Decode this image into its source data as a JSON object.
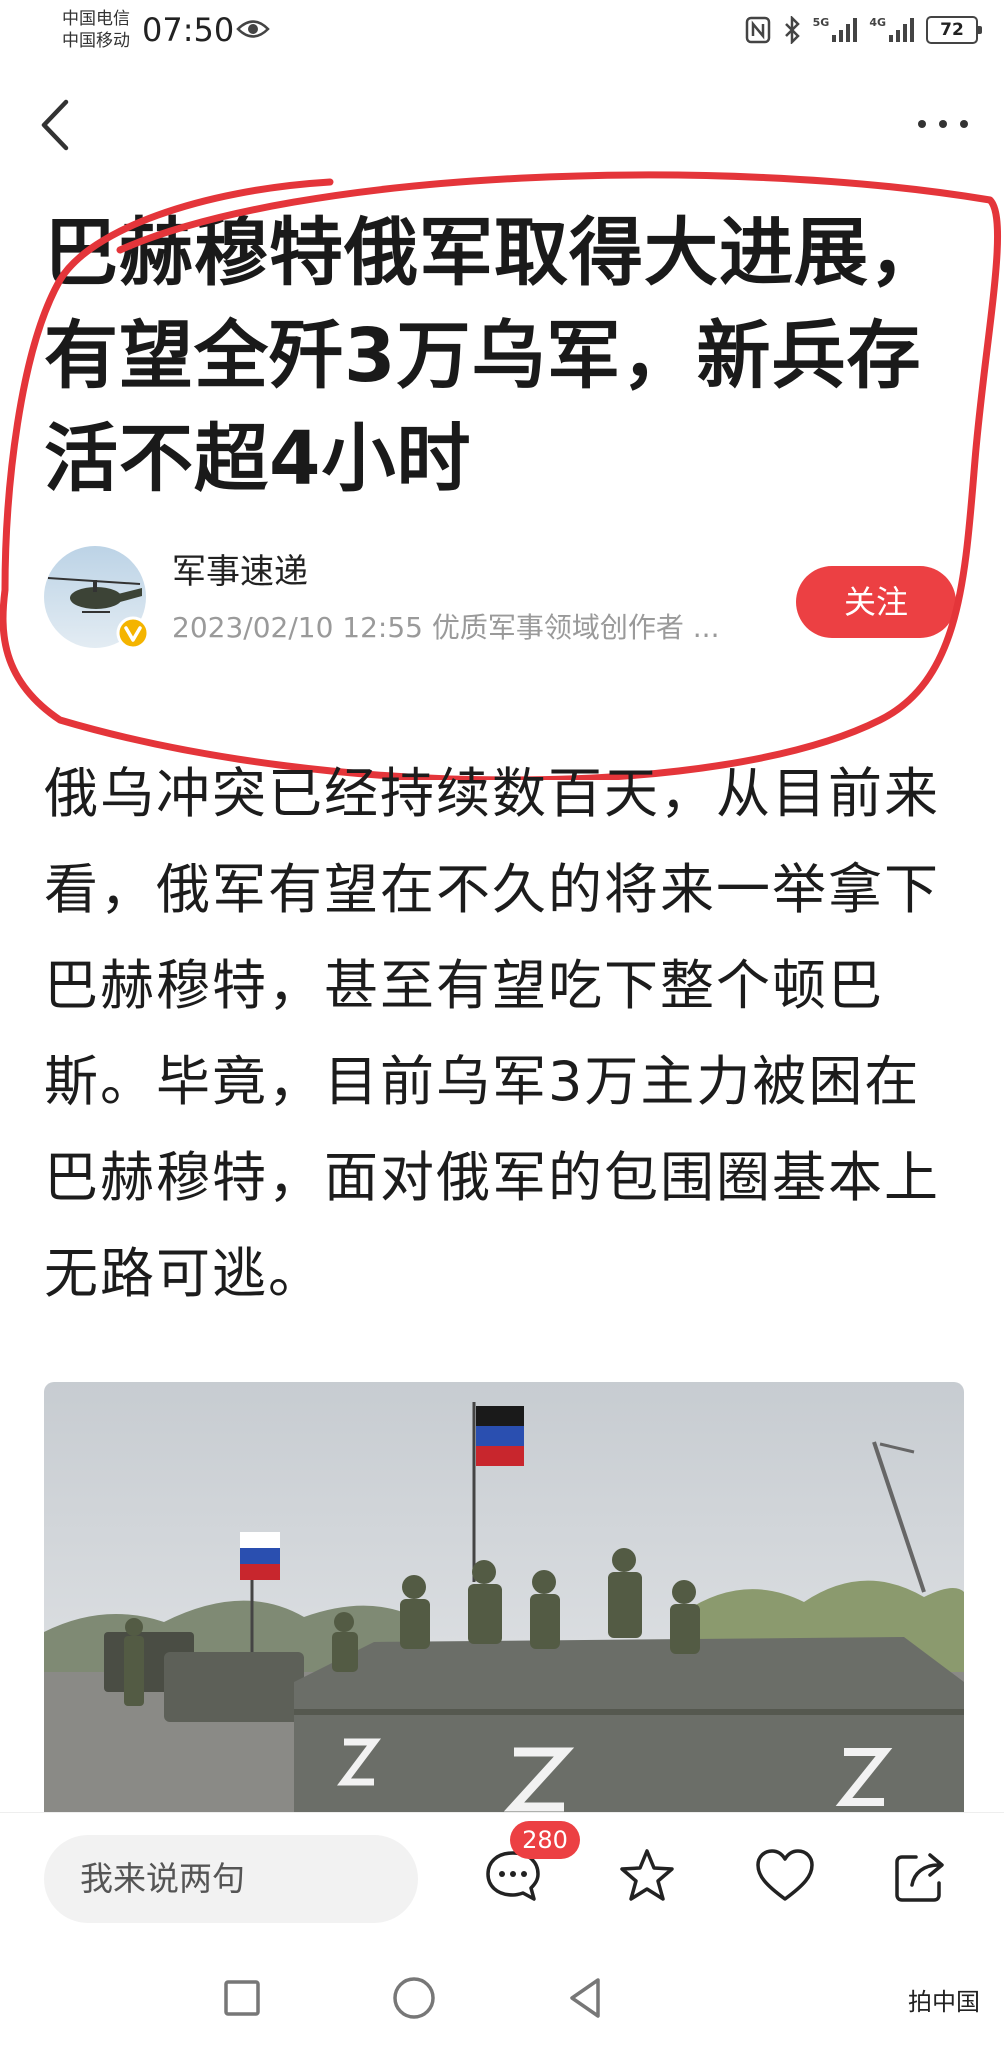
{
  "status_bar": {
    "carrier_1": "中国电信",
    "carrier_2": "中国移动",
    "time": "07:50",
    "signal_label_1": "5G",
    "signal_label_2": "4G",
    "battery": "72"
  },
  "article": {
    "headline": "巴赫穆特俄军取得大进展，有望全歼3万乌军，新兵存活不超4小时",
    "author": {
      "name": "军事速递",
      "meta": "2023/02/10 12:55  优质军事领域创作者 ..."
    },
    "follow_label": "关注",
    "body": "俄乌冲突已经持续数百天，从目前来看，俄军有望在不久的将来一举拿下巴赫穆特，甚至有望吃下整个顿巴斯。毕竟，目前乌军3万主力被困在巴赫穆特，面对俄军的包围圈基本上无路可逃。"
  },
  "action_bar": {
    "comment_placeholder": "我来说两句",
    "comment_count": "280"
  },
  "watermark": "拍中国",
  "colors": {
    "accent": "#ec4043",
    "annotation": "#e4353a"
  },
  "icons": [
    "back-arrow-icon",
    "more-dots-icon",
    "comment-icon",
    "star-icon",
    "heart-icon",
    "share-icon",
    "square-nav-icon",
    "circle-nav-icon",
    "triangle-back-nav-icon"
  ]
}
